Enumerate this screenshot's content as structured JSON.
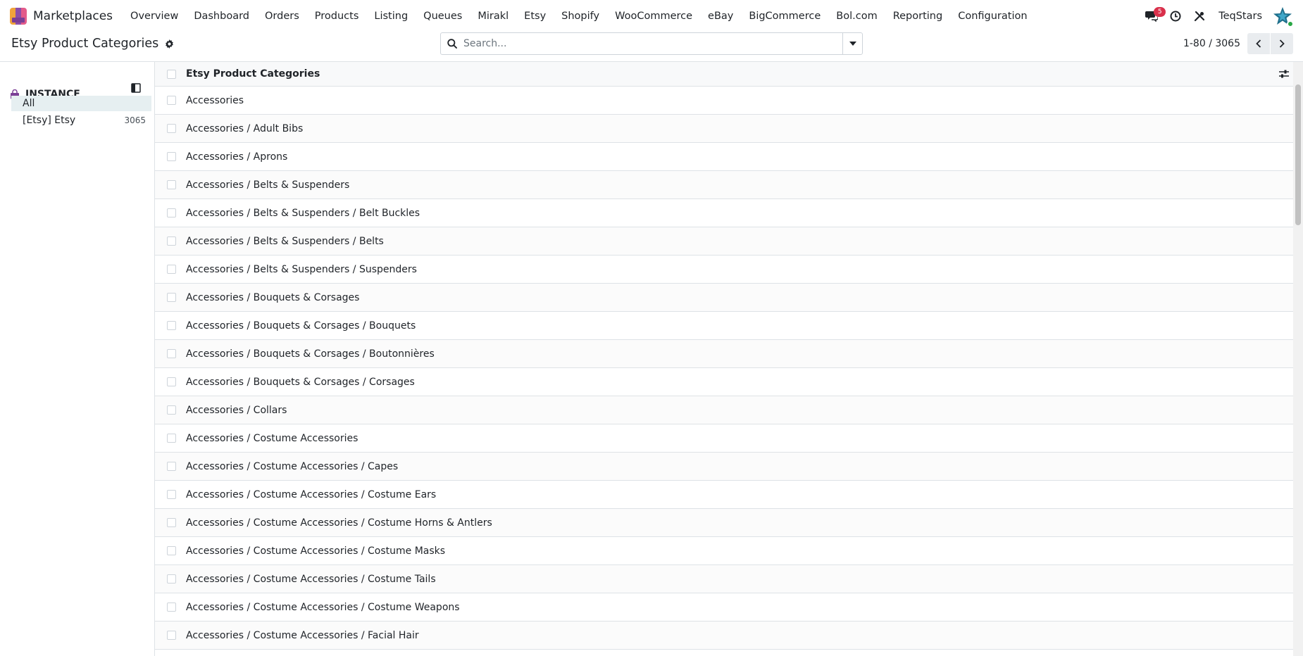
{
  "app": {
    "name": "Marketplaces"
  },
  "menu": [
    "Overview",
    "Dashboard",
    "Orders",
    "Products",
    "Listing",
    "Queues",
    "Mirakl",
    "Etsy",
    "Shopify",
    "WooCommerce",
    "eBay",
    "BigCommerce",
    "Bol.com",
    "Reporting",
    "Configuration"
  ],
  "systray": {
    "messages_count": "5",
    "company": "TeqStars"
  },
  "page": {
    "title": "Etsy Product Categories"
  },
  "search": {
    "placeholder": "Search..."
  },
  "pager": {
    "value": "1-80 / 3065"
  },
  "side_panel": {
    "heading": "INSTANCE",
    "items": [
      {
        "label": "All",
        "count": ""
      },
      {
        "label": "[Etsy] Etsy",
        "count": "3065"
      }
    ]
  },
  "list": {
    "column": "Etsy Product Categories",
    "rows": [
      "Accessories",
      "Accessories / Adult Bibs",
      "Accessories / Aprons",
      "Accessories / Belts & Suspenders",
      "Accessories / Belts & Suspenders / Belt Buckles",
      "Accessories / Belts & Suspenders / Belts",
      "Accessories / Belts & Suspenders / Suspenders",
      "Accessories / Bouquets & Corsages",
      "Accessories / Bouquets & Corsages / Bouquets",
      "Accessories / Bouquets & Corsages / Boutonnières",
      "Accessories / Bouquets & Corsages / Corsages",
      "Accessories / Collars",
      "Accessories / Costume Accessories",
      "Accessories / Costume Accessories / Capes",
      "Accessories / Costume Accessories / Costume Ears",
      "Accessories / Costume Accessories / Costume Horns & Antlers",
      "Accessories / Costume Accessories / Costume Masks",
      "Accessories / Costume Accessories / Costume Tails",
      "Accessories / Costume Accessories / Costume Weapons",
      "Accessories / Costume Accessories / Facial Hair"
    ]
  },
  "colors": {
    "badge": "#d9304b",
    "active_filter_bg": "#e6eff1",
    "status_online": "#28a745"
  }
}
